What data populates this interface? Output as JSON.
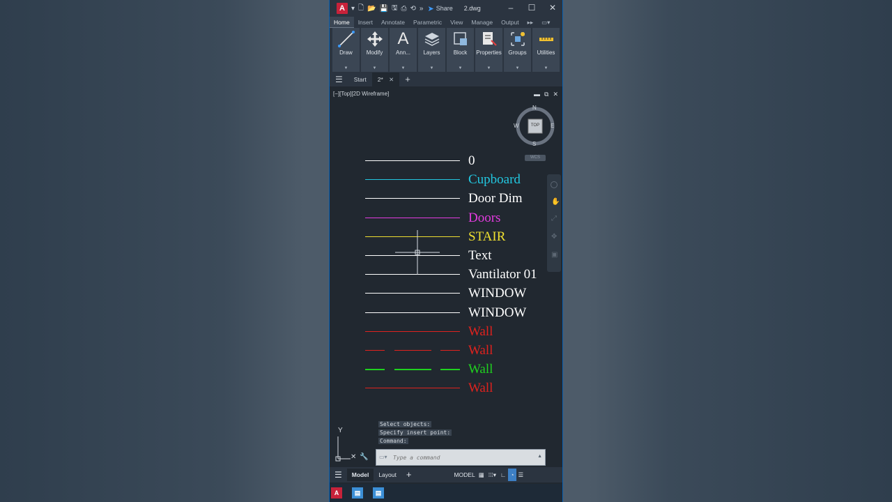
{
  "app": {
    "logo_letter": "A",
    "share_label": "Share",
    "document_title": "2.dwg"
  },
  "ribbon_tabs": [
    "Home",
    "Insert",
    "Annotate",
    "Parametric",
    "View",
    "Manage",
    "Output"
  ],
  "ribbon_panels": [
    "Draw",
    "Modify",
    "Ann...",
    "Layers",
    "Block",
    "Properties",
    "Groups",
    "Utilities"
  ],
  "file_tabs": {
    "start": "Start",
    "active": "2*"
  },
  "viewport": {
    "label": "[−][Top][2D Wireframe]",
    "viewcube": {
      "top": "TOP",
      "north": "N",
      "south": "S",
      "east": "E",
      "west": "W"
    },
    "wcs": "WCS"
  },
  "layers": [
    {
      "name": "0",
      "color": "#ffffff",
      "line": "solid"
    },
    {
      "name": "Cupboard",
      "color": "#22c7e0",
      "line": "solid"
    },
    {
      "name": "Door Dim",
      "color": "#ffffff",
      "line": "solid"
    },
    {
      "name": "Doors",
      "color": "#e43be0",
      "line": "solid"
    },
    {
      "name": "STAIR",
      "color": "#f0e030",
      "line": "solid"
    },
    {
      "name": "Text",
      "color": "#ffffff",
      "line": "solid"
    },
    {
      "name": "Vantilator 01",
      "color": "#ffffff",
      "line": "solid"
    },
    {
      "name": "WINDOW",
      "color": "#ffffff",
      "line": "solid"
    },
    {
      "name": "WINDOW",
      "color": "#ffffff",
      "line": "solid"
    },
    {
      "name": "Wall",
      "color": "#e0221e",
      "line": "solid"
    },
    {
      "name": "Wall",
      "color": "#e0221e",
      "line": "dashed"
    },
    {
      "name": "Wall",
      "color": "#1fd21f",
      "line": "dashed"
    },
    {
      "name": "Wall",
      "color": "#e0221e",
      "line": "solid"
    }
  ],
  "command": {
    "history": [
      "Select objects:",
      "Specify insert point:",
      "Command:"
    ],
    "placeholder": "Type a command"
  },
  "ucs": {
    "y_label": "Y"
  },
  "status": {
    "model": "Model",
    "layout": "Layout",
    "model_space": "MODEL"
  },
  "colors": {
    "accent": "#0a62b3",
    "background": "#212830",
    "logo": "#c8223a"
  }
}
